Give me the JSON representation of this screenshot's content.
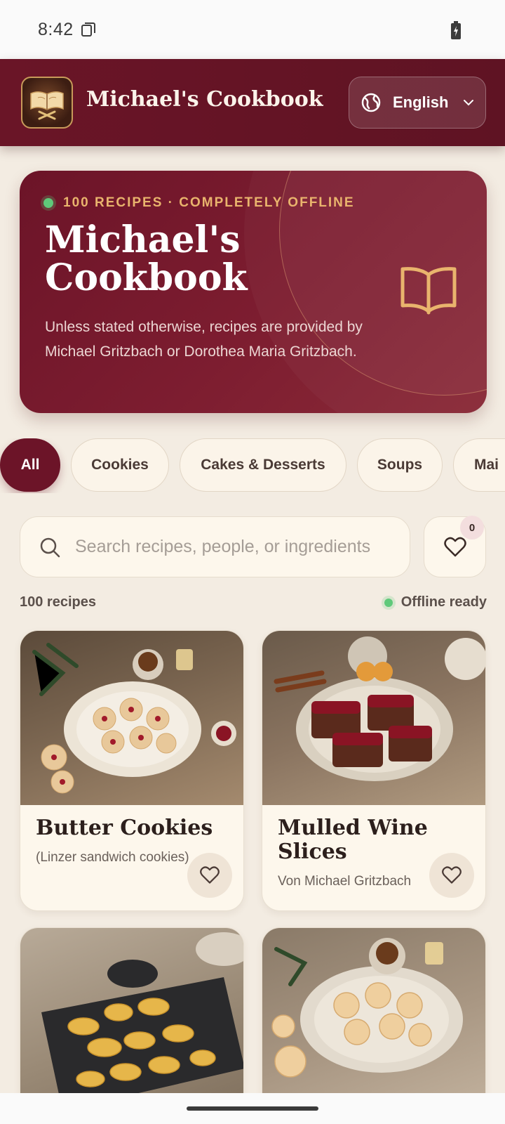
{
  "status_bar": {
    "time": "8:42"
  },
  "header": {
    "title": "Michael's Cookbook",
    "language": "English"
  },
  "hero": {
    "badge": "100 RECIPES · COMPLETELY OFFLINE",
    "title": "Michael's Cookbook",
    "description": "Unless stated otherwise, recipes are provided by Michael Gritzbach or Dorothea Maria Gritzbach."
  },
  "categories": [
    "All",
    "Cookies",
    "Cakes & Desserts",
    "Soups",
    "Mai"
  ],
  "search": {
    "placeholder": "Search recipes, people, or ingredients"
  },
  "favorites": {
    "count": "0"
  },
  "summary": {
    "count": "100 recipes",
    "offline": "Offline ready"
  },
  "recipes": [
    {
      "title": "Butter Cookies",
      "subtitle": "(Linzer sandwich cookies)"
    },
    {
      "title": "Mulled Wine Slices",
      "subtitle": "Von Michael Gritzbach"
    },
    {
      "title": "",
      "subtitle": ""
    },
    {
      "title": "",
      "subtitle": ""
    }
  ],
  "colors": {
    "brand": "#6c1428",
    "accent": "#e9b46d",
    "background": "#f3ece2",
    "online": "#5fc97a"
  }
}
